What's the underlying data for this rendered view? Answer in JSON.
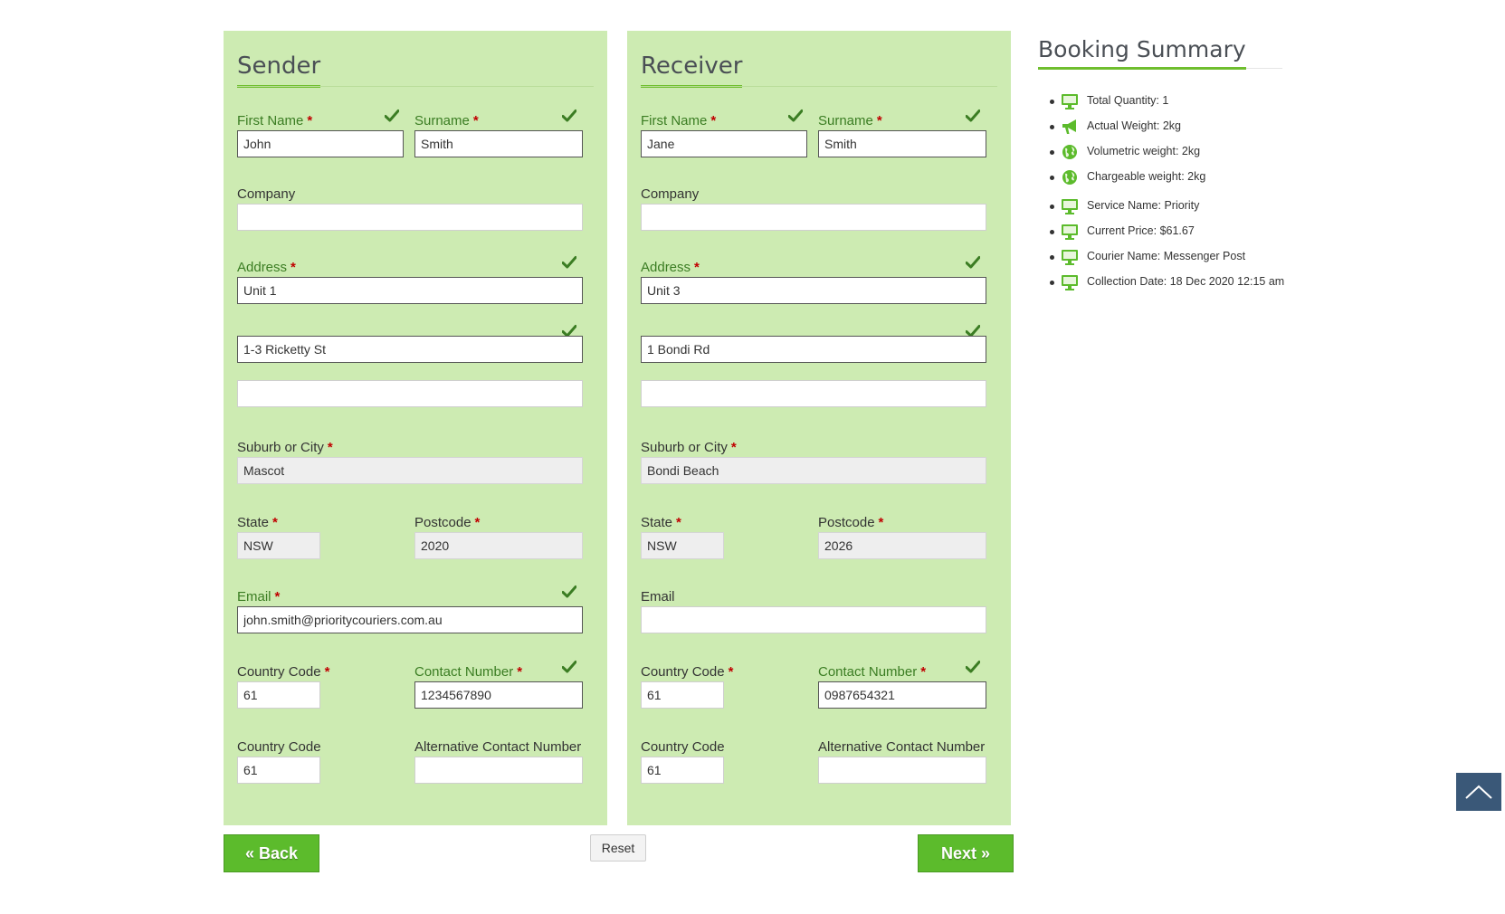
{
  "sender": {
    "title": "Sender",
    "first_name_label": "First Name",
    "first_name": "John",
    "surname_label": "Surname",
    "surname": "Smith",
    "company_label": "Company",
    "company": "",
    "address_label": "Address",
    "address_line1": "Unit 1",
    "address_line2": "1-3 Ricketty St",
    "address_line3": "",
    "suburb_label": "Suburb or City",
    "suburb": "Mascot",
    "state_label": "State",
    "state": "NSW",
    "postcode_label": "Postcode",
    "postcode": "2020",
    "email_label": "Email",
    "email": "john.smith@prioritycouriers.com.au",
    "country_code_label": "Country Code",
    "country_code": "61",
    "contact_label": "Contact Number",
    "contact": "1234567890",
    "alt_country_code_label": "Country Code",
    "alt_country_code": "61",
    "alt_contact_label": "Alternative Contact Number",
    "alt_contact": ""
  },
  "receiver": {
    "title": "Receiver",
    "first_name_label": "First Name",
    "first_name": "Jane",
    "surname_label": "Surname",
    "surname": "Smith",
    "company_label": "Company",
    "company": "",
    "address_label": "Address",
    "address_line1": "Unit 3",
    "address_line2": "1 Bondi Rd",
    "address_line3": "",
    "suburb_label": "Suburb or City",
    "suburb": "Bondi Beach",
    "state_label": "State",
    "state": "NSW",
    "postcode_label": "Postcode",
    "postcode": "2026",
    "email_label": "Email",
    "email": "",
    "country_code_label": "Country Code",
    "country_code": "61",
    "contact_label": "Contact Number",
    "contact": "0987654321",
    "alt_country_code_label": "Country Code",
    "alt_country_code": "61",
    "alt_contact_label": "Alternative Contact Number",
    "alt_contact": ""
  },
  "required_marker": "*",
  "buttons": {
    "back": "« Back",
    "reset": "Reset",
    "next": "Next »"
  },
  "summary": {
    "title": "Booking Summary",
    "items": [
      {
        "icon": "monitor-icon",
        "text": "Total Quantity: 1"
      },
      {
        "icon": "megaphone-icon",
        "text": "Actual Weight: 2kg"
      },
      {
        "icon": "globe-icon",
        "text": "Volumetric weight: 2kg"
      },
      {
        "icon": "globe-icon",
        "text": "Chargeable weight: 2kg"
      },
      {
        "icon": "monitor-icon",
        "text": "Service Name: Priority"
      },
      {
        "icon": "monitor-icon",
        "text": "Current Price: $61.67"
      },
      {
        "icon": "monitor-icon",
        "text": "Courier Name: Messenger Post"
      },
      {
        "icon": "monitor-icon",
        "text": "Collection Date: 18 Dec 2020 12:15 am"
      }
    ]
  },
  "colors": {
    "panel_background": "#cdebb2",
    "accent_green": "#5cbb2c",
    "valid_label": "#3b7d23",
    "required_star": "#c00000",
    "scroll_top_button": "#3a5878"
  }
}
